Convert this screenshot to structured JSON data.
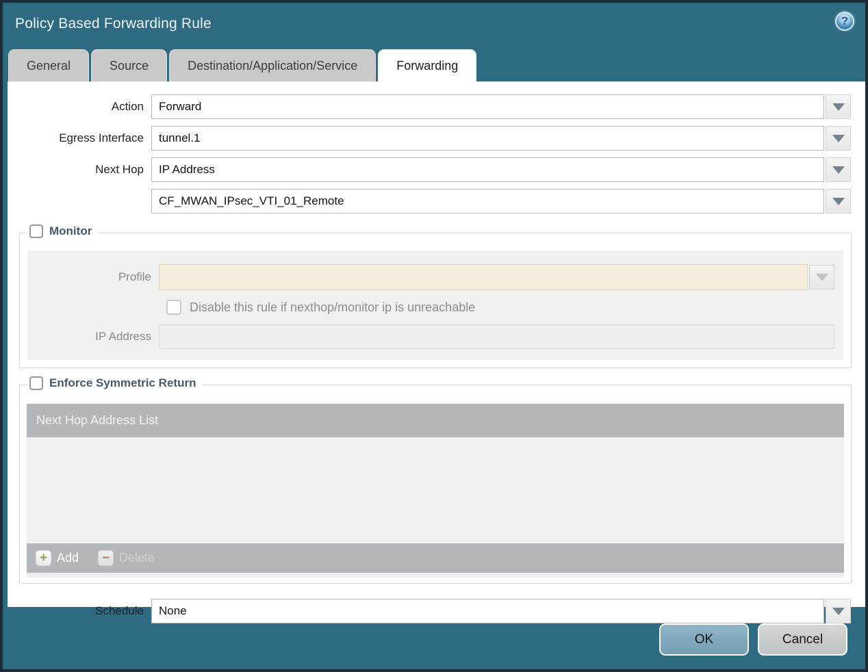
{
  "dialog": {
    "title": "Policy Based Forwarding Rule",
    "help_glyph": "?"
  },
  "tabs": [
    {
      "label": "General",
      "active": false
    },
    {
      "label": "Source",
      "active": false
    },
    {
      "label": "Destination/Application/Service",
      "active": false
    },
    {
      "label": "Forwarding",
      "active": true
    }
  ],
  "form": {
    "action": {
      "label": "Action",
      "value": "Forward"
    },
    "egress_interface": {
      "label": "Egress Interface",
      "value": "tunnel.1"
    },
    "next_hop": {
      "label": "Next Hop",
      "value": "IP Address"
    },
    "next_hop_address": {
      "value": "CF_MWAN_IPsec_VTI_01_Remote"
    },
    "schedule": {
      "label": "Schedule",
      "value": "None"
    }
  },
  "monitor": {
    "legend": "Monitor",
    "checked": false,
    "profile": {
      "label": "Profile",
      "value": ""
    },
    "disable_rule": {
      "label": "Disable this rule if nexthop/monitor ip is unreachable",
      "checked": false
    },
    "ip_address": {
      "label": "IP Address",
      "value": ""
    }
  },
  "symmetric_return": {
    "legend": "Enforce Symmetric Return",
    "checked": false,
    "table": {
      "header": "Next Hop Address List",
      "rows": [],
      "add_label": "Add",
      "add_glyph": "+",
      "delete_label": "Delete",
      "delete_glyph": "−",
      "delete_disabled": true
    }
  },
  "footer": {
    "ok_label": "OK",
    "cancel_label": "Cancel"
  },
  "colors": {
    "frame_teal": "#2e6b83",
    "outer_border": "#1d2c36",
    "tab_inactive": "#c9c9c9",
    "table_gray": "#b3b7ba",
    "table_body": "#f0f0f1",
    "monitor_panel": "#f0f0ef",
    "profile_beige": "#f5eedc",
    "legend_text": "#46586a",
    "ok_button": "#7da7ba",
    "cancel_button": "#c8cbcd",
    "add_green": "#8aa63f",
    "delete_red": "#b07a6c"
  }
}
